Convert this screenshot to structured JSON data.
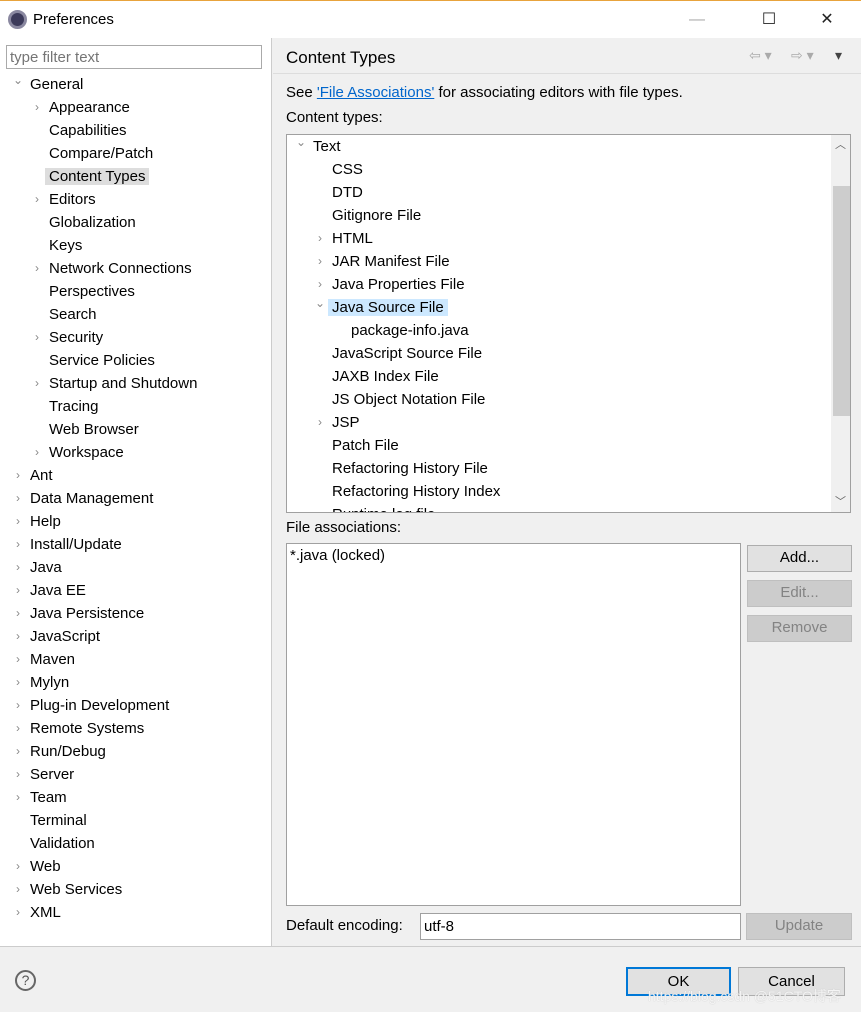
{
  "window": {
    "title": "Preferences",
    "minimize": "—",
    "maximize": "☐",
    "close": "✕"
  },
  "sidebar": {
    "filter_placeholder": "type filter text",
    "items": [
      {
        "label": "General",
        "level": 0,
        "tw": "open"
      },
      {
        "label": "Appearance",
        "level": 1,
        "tw": "closed"
      },
      {
        "label": "Capabilities",
        "level": 1,
        "tw": ""
      },
      {
        "label": "Compare/Patch",
        "level": 1,
        "tw": ""
      },
      {
        "label": "Content Types",
        "level": 1,
        "tw": "",
        "selected": true
      },
      {
        "label": "Editors",
        "level": 1,
        "tw": "closed"
      },
      {
        "label": "Globalization",
        "level": 1,
        "tw": ""
      },
      {
        "label": "Keys",
        "level": 1,
        "tw": ""
      },
      {
        "label": "Network Connections",
        "level": 1,
        "tw": "closed"
      },
      {
        "label": "Perspectives",
        "level": 1,
        "tw": ""
      },
      {
        "label": "Search",
        "level": 1,
        "tw": ""
      },
      {
        "label": "Security",
        "level": 1,
        "tw": "closed"
      },
      {
        "label": "Service Policies",
        "level": 1,
        "tw": ""
      },
      {
        "label": "Startup and Shutdown",
        "level": 1,
        "tw": "closed"
      },
      {
        "label": "Tracing",
        "level": 1,
        "tw": ""
      },
      {
        "label": "Web Browser",
        "level": 1,
        "tw": ""
      },
      {
        "label": "Workspace",
        "level": 1,
        "tw": "closed"
      },
      {
        "label": "Ant",
        "level": 0,
        "tw": "closed"
      },
      {
        "label": "Data Management",
        "level": 0,
        "tw": "closed"
      },
      {
        "label": "Help",
        "level": 0,
        "tw": "closed"
      },
      {
        "label": "Install/Update",
        "level": 0,
        "tw": "closed"
      },
      {
        "label": "Java",
        "level": 0,
        "tw": "closed"
      },
      {
        "label": "Java EE",
        "level": 0,
        "tw": "closed"
      },
      {
        "label": "Java Persistence",
        "level": 0,
        "tw": "closed"
      },
      {
        "label": "JavaScript",
        "level": 0,
        "tw": "closed"
      },
      {
        "label": "Maven",
        "level": 0,
        "tw": "closed"
      },
      {
        "label": "Mylyn",
        "level": 0,
        "tw": "closed"
      },
      {
        "label": "Plug-in Development",
        "level": 0,
        "tw": "closed"
      },
      {
        "label": "Remote Systems",
        "level": 0,
        "tw": "closed"
      },
      {
        "label": "Run/Debug",
        "level": 0,
        "tw": "closed"
      },
      {
        "label": "Server",
        "level": 0,
        "tw": "closed"
      },
      {
        "label": "Team",
        "level": 0,
        "tw": "closed"
      },
      {
        "label": "Terminal",
        "level": 0,
        "tw": ""
      },
      {
        "label": "Validation",
        "level": 0,
        "tw": ""
      },
      {
        "label": "Web",
        "level": 0,
        "tw": "closed"
      },
      {
        "label": "Web Services",
        "level": 0,
        "tw": "closed"
      },
      {
        "label": "XML",
        "level": 0,
        "tw": "closed"
      }
    ]
  },
  "page": {
    "title": "Content Types",
    "intro_prefix": "See ",
    "intro_link": "'File Associations'",
    "intro_suffix": " for associating editors with file types.",
    "content_types_label": "Content types:",
    "content_types": [
      {
        "label": "Text",
        "level": 0,
        "tw": "open"
      },
      {
        "label": "CSS",
        "level": 1,
        "tw": ""
      },
      {
        "label": "DTD",
        "level": 1,
        "tw": ""
      },
      {
        "label": "Gitignore File",
        "level": 1,
        "tw": ""
      },
      {
        "label": "HTML",
        "level": 1,
        "tw": "closed"
      },
      {
        "label": "JAR Manifest File",
        "level": 1,
        "tw": "closed"
      },
      {
        "label": "Java Properties File",
        "level": 1,
        "tw": "closed"
      },
      {
        "label": "Java Source File",
        "level": 1,
        "tw": "open",
        "selected": true
      },
      {
        "label": "package-info.java",
        "level": 2,
        "tw": ""
      },
      {
        "label": "JavaScript Source File",
        "level": 1,
        "tw": ""
      },
      {
        "label": "JAXB Index File",
        "level": 1,
        "tw": ""
      },
      {
        "label": "JS Object Notation File",
        "level": 1,
        "tw": ""
      },
      {
        "label": "JSP",
        "level": 1,
        "tw": "closed"
      },
      {
        "label": "Patch File",
        "level": 1,
        "tw": ""
      },
      {
        "label": "Refactoring History File",
        "level": 1,
        "tw": ""
      },
      {
        "label": "Refactoring History Index",
        "level": 1,
        "tw": ""
      },
      {
        "label": "Runtime log file",
        "level": 1,
        "tw": ""
      }
    ],
    "file_assoc_label": "File associations:",
    "file_assoc": [
      "*.java (locked)"
    ],
    "add": "Add...",
    "edit": "Edit...",
    "remove": "Remove",
    "encoding_label": "Default encoding:",
    "encoding_value": "utf-8",
    "update": "Update"
  },
  "footer": {
    "help": "?",
    "ok": "OK",
    "cancel": "Cancel",
    "watermark": "https://blog.csdn @51CTO博客"
  }
}
